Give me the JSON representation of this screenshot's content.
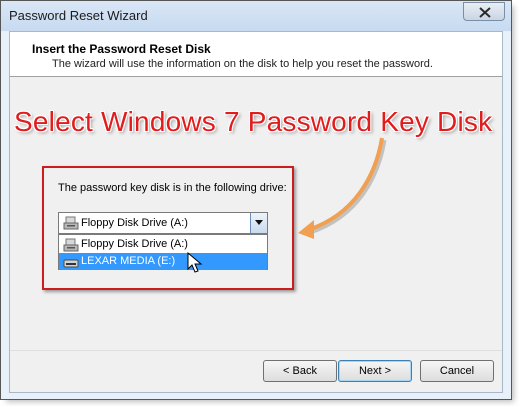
{
  "window": {
    "title": "Password Reset Wizard"
  },
  "header": {
    "title": "Insert the Password Reset Disk",
    "description": "The wizard will use the information on the disk to help you reset the password."
  },
  "annotation": {
    "text": "Select Windows 7 Password Key Disk",
    "color": "#e11c1c"
  },
  "drive": {
    "label": "The password key disk is in the following drive:",
    "selected": "Floppy Disk Drive (A:)",
    "options": [
      {
        "label": "Floppy Disk Drive (A:)",
        "icon": "floppy-drive-icon",
        "highlighted": false
      },
      {
        "label": "LEXAR MEDIA (E:)",
        "icon": "usb-drive-icon",
        "highlighted": true
      }
    ]
  },
  "buttons": {
    "back": "< Back",
    "next": "Next >",
    "cancel": "Cancel"
  },
  "colors": {
    "highlight": "#3399ff",
    "accent_border": "#cc1c1c",
    "arrow": "#f0a050"
  }
}
